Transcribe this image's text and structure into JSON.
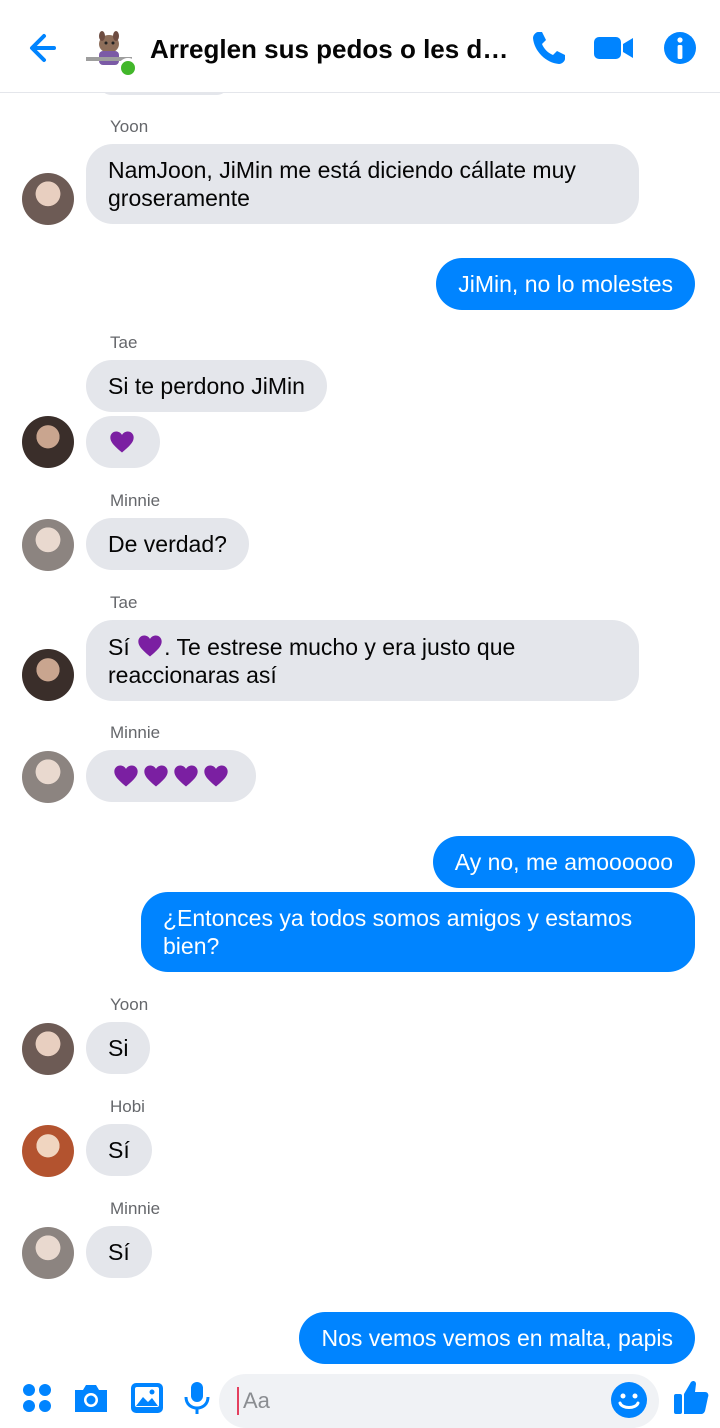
{
  "header": {
    "title": "Arreglen sus pedos o les doy en...",
    "accent": "#0084ff"
  },
  "messages": [
    {
      "sender": "Yoon",
      "dir": "in",
      "text": "NamJoon, JiMin me está diciendo cállate muy groseramente"
    },
    {
      "dir": "out",
      "text": "JiMin, no lo molestes"
    },
    {
      "sender": "Tae",
      "dir": "in",
      "text": "Si te perdono JiMin"
    },
    {
      "sender": "Tae",
      "dir": "in",
      "text": "💜"
    },
    {
      "sender": "Minnie",
      "dir": "in",
      "text": "De verdad?"
    },
    {
      "sender": "Tae",
      "dir": "in",
      "text": "Sí 💜. Te estrese mucho y era justo que reaccionaras así"
    },
    {
      "sender": "Minnie",
      "dir": "in",
      "text": "💜💜💜💜"
    },
    {
      "dir": "out",
      "text": "Ay no, me amoooooo"
    },
    {
      "dir": "out",
      "text": "¿Entonces ya todos somos amigos y estamos bien?"
    },
    {
      "sender": "Yoon",
      "dir": "in",
      "text": "Si"
    },
    {
      "sender": "Hobi",
      "dir": "in",
      "text": "Sí"
    },
    {
      "sender": "Minnie",
      "dir": "in",
      "text": "Sí"
    },
    {
      "dir": "out",
      "text": "Nos vemos vemos en malta, papis"
    }
  ],
  "labels": {
    "yoon": "Yoon",
    "tae": "Tae",
    "minnie": "Minnie",
    "hobi": "Hobi"
  },
  "composer": {
    "placeholder": "Aa"
  },
  "icons": [
    "back-arrow-icon",
    "phone-icon",
    "video-icon",
    "info-icon",
    "apps-icon",
    "camera-icon",
    "gallery-icon",
    "mic-icon",
    "emoji-icon",
    "like-icon",
    "heart-icon"
  ]
}
